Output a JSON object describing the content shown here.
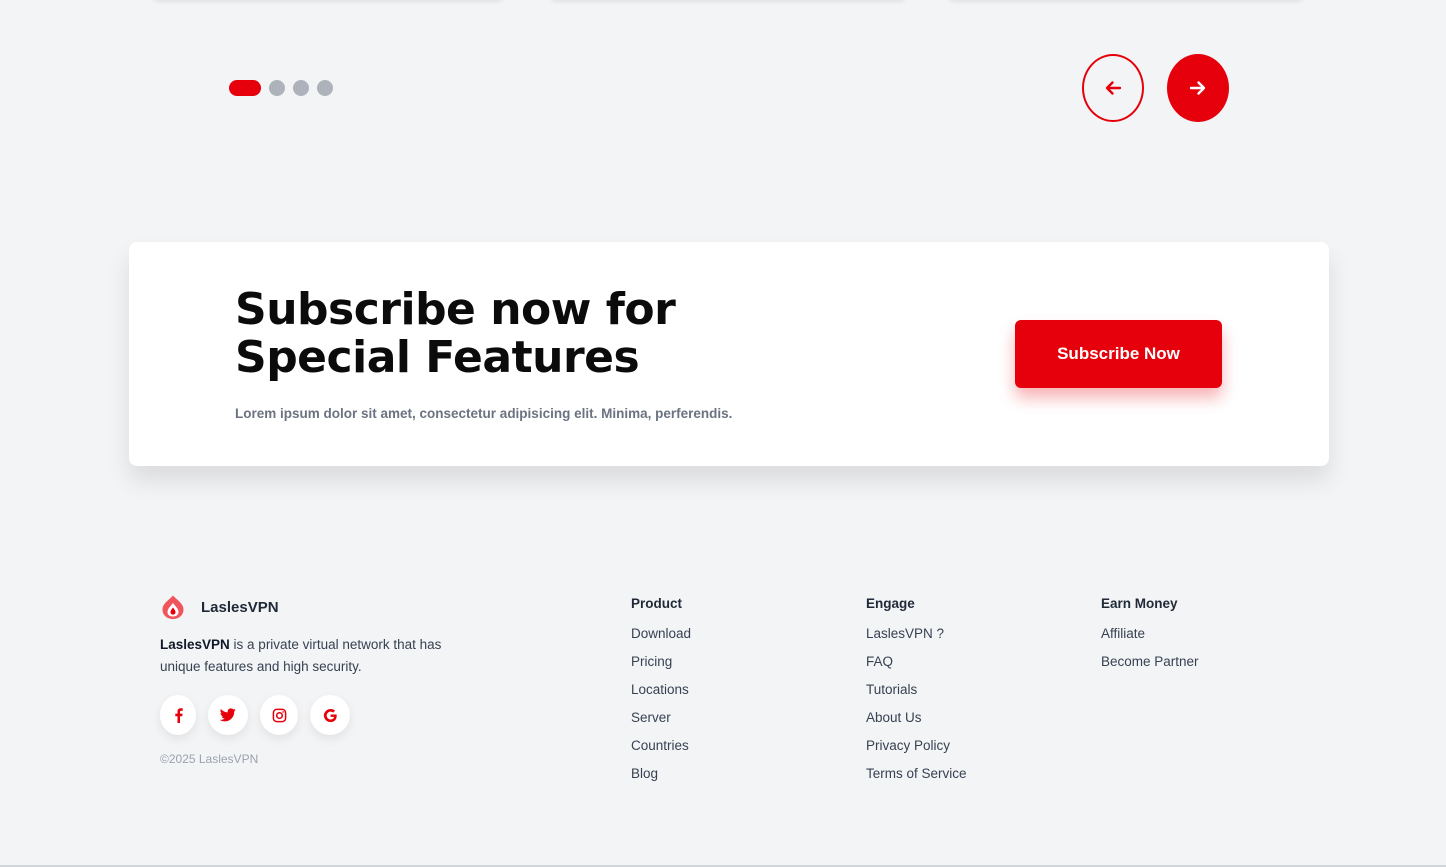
{
  "colors": {
    "accent": "#e5000b",
    "background": "#f3f4f6",
    "dot_inactive": "#aeb3bb",
    "text_muted": "#6b7280"
  },
  "carousel": {
    "dots": [
      {
        "state": "active"
      },
      {
        "state": "inactive"
      },
      {
        "state": "inactive"
      },
      {
        "state": "inactive"
      }
    ],
    "prev_icon": "arrow-left-icon",
    "next_icon": "arrow-right-icon"
  },
  "subscribe": {
    "title_line1": "Subscribe now for",
    "title_line2": "Special Features",
    "description": "Lorem ipsum dolor sit amet, consectetur adipisicing elit. Minima, perferendis.",
    "button_label": "Subscribe Now"
  },
  "footer": {
    "brand_name": "LaslesVPN",
    "brand_icon": "flame-logo-icon",
    "about_brand": "LaslesVPN",
    "about_text": " is a private virtual network that has unique features and high security.",
    "socials": [
      {
        "icon": "facebook-icon"
      },
      {
        "icon": "twitter-icon"
      },
      {
        "icon": "instagram-icon"
      },
      {
        "icon": "google-icon"
      }
    ],
    "copyright": "©2025 LaslesVPN",
    "columns": {
      "product": {
        "title": "Product",
        "links": [
          "Download",
          "Pricing",
          "Locations",
          "Server",
          "Countries",
          "Blog"
        ]
      },
      "engage": {
        "title": "Engage",
        "links": [
          "LaslesVPN ?",
          "FAQ",
          "Tutorials",
          "About Us",
          "Privacy Policy",
          "Terms of Service"
        ]
      },
      "earn": {
        "title": "Earn Money",
        "links": [
          "Affiliate",
          "Become Partner"
        ]
      }
    }
  }
}
